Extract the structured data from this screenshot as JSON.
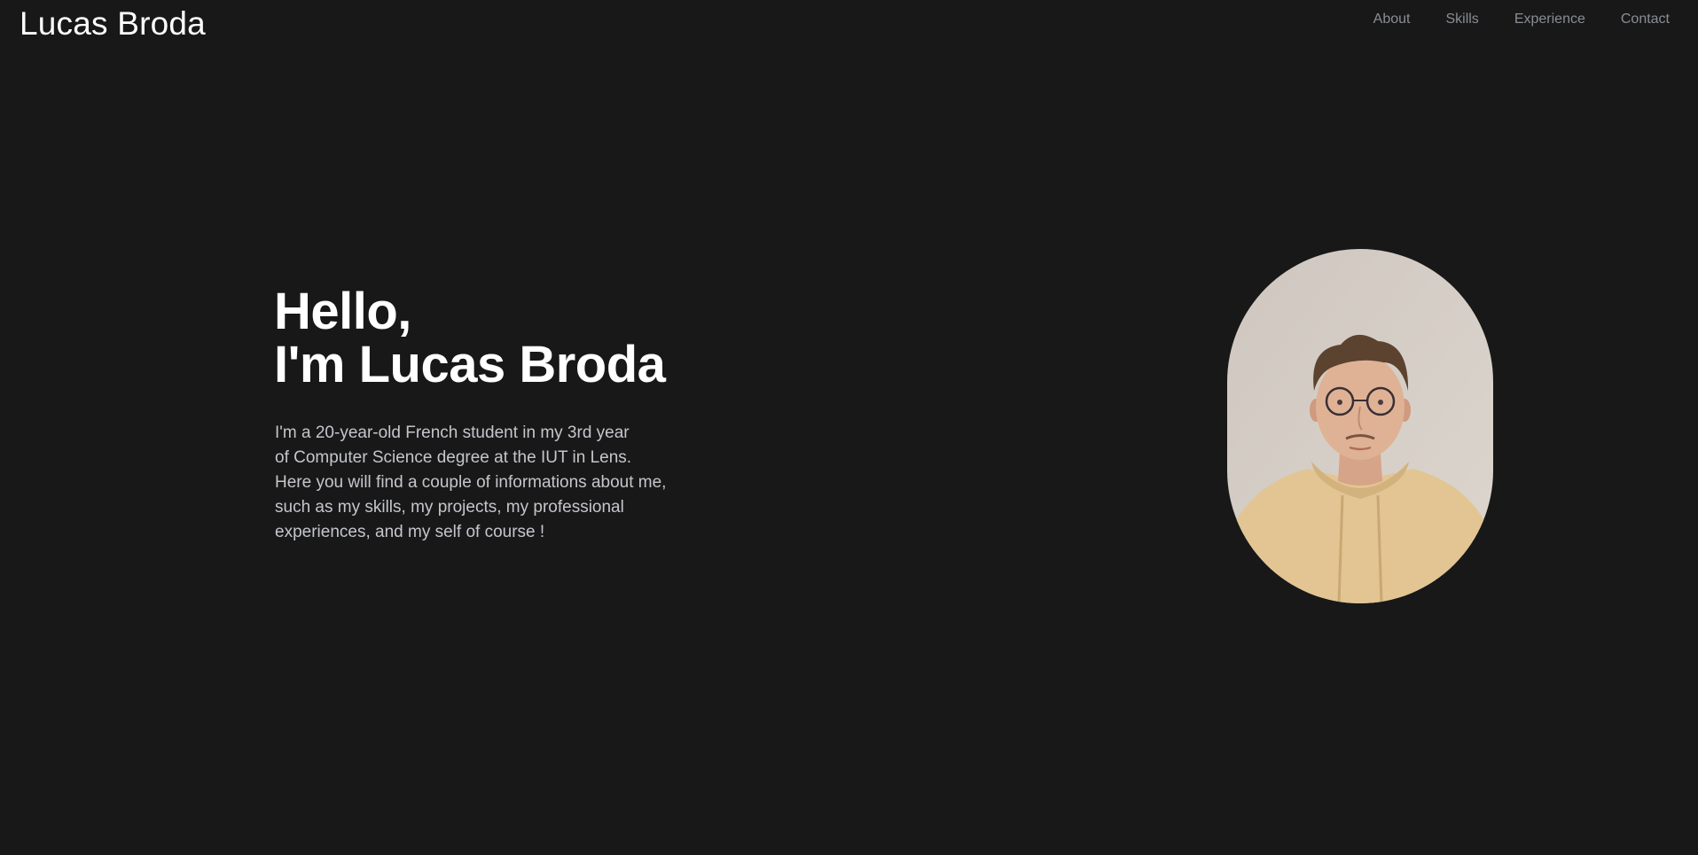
{
  "header": {
    "brand": "Lucas Broda",
    "nav": [
      "About",
      "Skills",
      "Experience",
      "Contact"
    ]
  },
  "hero": {
    "title_line1": "Hello,",
    "title_line2": "I'm Lucas Broda",
    "intro_lines": [
      "I'm a 20-year-old French student in my 3rd year",
      "of Computer Science degree at the IUT in Lens.",
      "Here you will find a couple of informations about me,",
      "such as my skills, my projects, my professional",
      "experiences, and my self of course !"
    ]
  },
  "colors": {
    "background": "#181818",
    "text_primary": "#ffffff",
    "text_secondary": "#c4c6cc",
    "nav_text": "#8a8d96"
  }
}
